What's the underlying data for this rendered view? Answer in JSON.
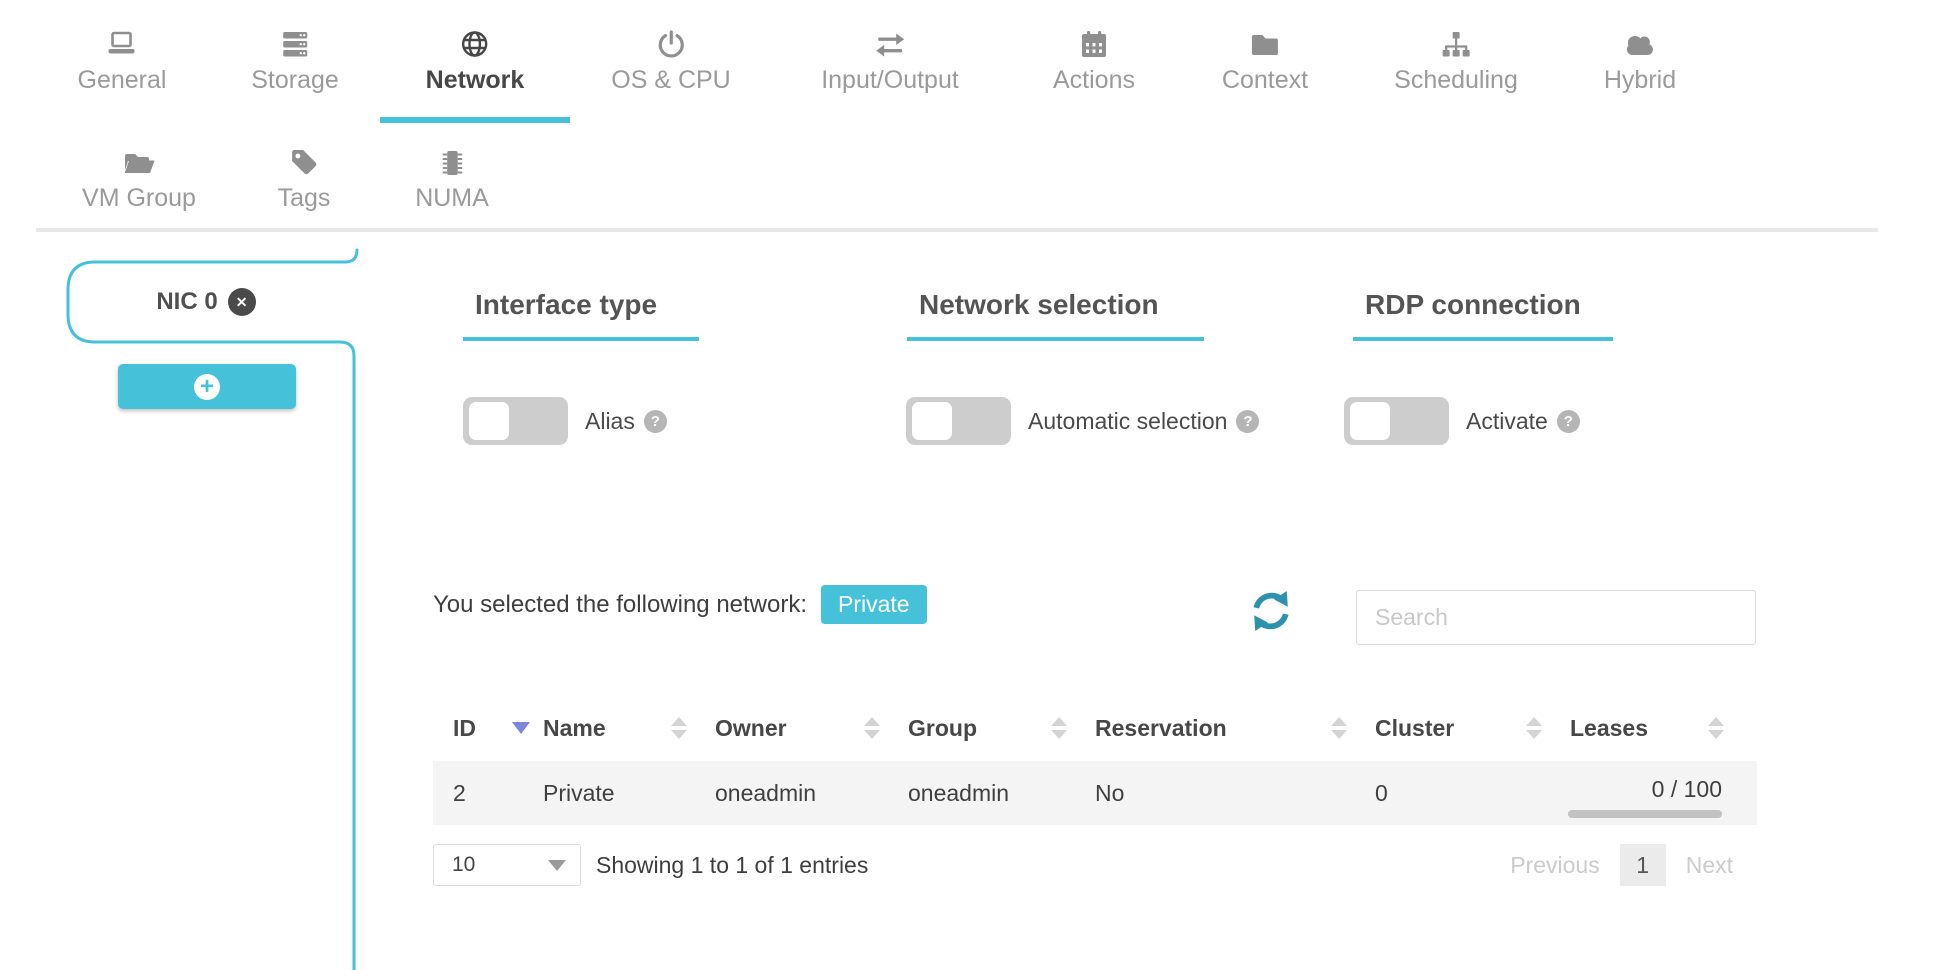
{
  "wizard_tabs": {
    "row1": [
      {
        "label": "General",
        "icon": "laptop-icon",
        "active": false
      },
      {
        "label": "Storage",
        "icon": "server-icon",
        "active": false
      },
      {
        "label": "Network",
        "icon": "globe-icon",
        "active": true
      },
      {
        "label": "OS & CPU",
        "icon": "power-icon",
        "active": false
      },
      {
        "label": "Input/Output",
        "icon": "exchange-icon",
        "active": false
      },
      {
        "label": "Actions",
        "icon": "calendar-icon",
        "active": false
      },
      {
        "label": "Context",
        "icon": "folder-icon",
        "active": false
      },
      {
        "label": "Scheduling",
        "icon": "sitemap-icon",
        "active": false
      },
      {
        "label": "Hybrid",
        "icon": "cloud-icon",
        "active": false
      }
    ],
    "row2": [
      {
        "label": "VM Group",
        "icon": "folder-open-icon",
        "active": false
      },
      {
        "label": "Tags",
        "icon": "tag-icon",
        "active": false
      },
      {
        "label": "NUMA",
        "icon": "microchip-icon",
        "active": false
      }
    ]
  },
  "nic_panel": {
    "tab_label": "NIC 0",
    "close_glyph": "✕",
    "add_glyph": "+"
  },
  "sections": {
    "interface_type": {
      "title": "Interface type",
      "toggle_label": "Alias",
      "toggle_state": "off",
      "help_glyph": "?"
    },
    "network_selection": {
      "title": "Network selection",
      "toggle_label": "Automatic selection",
      "toggle_state": "off",
      "help_glyph": "?"
    },
    "rdp_connection": {
      "title": "RDP connection",
      "toggle_label": "Activate",
      "toggle_state": "off",
      "help_glyph": "?"
    }
  },
  "network_table": {
    "selected_text": "You selected the following network:",
    "selected_network": "Private",
    "search_placeholder": "Search",
    "headers": [
      "ID",
      "Name",
      "Owner",
      "Group",
      "Reservation",
      "Cluster",
      "Leases"
    ],
    "sorted_by": "ID",
    "sort_direction": "desc",
    "rows": [
      {
        "id": "2",
        "name": "Private",
        "owner": "oneadmin",
        "group": "oneadmin",
        "reservation": "No",
        "cluster": "0",
        "leases": "0 / 100",
        "leases_used": 0,
        "leases_total": 100
      }
    ],
    "page_length": "10",
    "showing_text": "Showing 1 to 1 of 1 entries",
    "pagination": {
      "previous": "Previous",
      "current_page": "1",
      "next": "Next"
    }
  },
  "colors": {
    "accent_teal": "#45c2da",
    "refresh_teal": "#2c93ae",
    "sort_active_blue": "#7d85dc"
  }
}
